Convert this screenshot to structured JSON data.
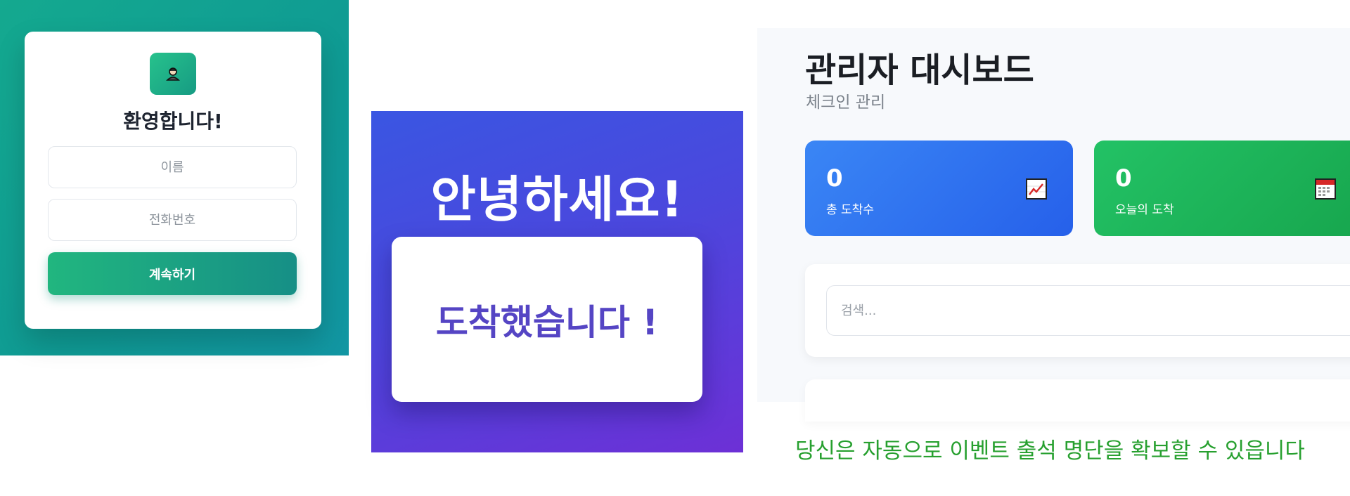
{
  "login": {
    "title": "환영합니다!",
    "name_placeholder": "이름",
    "phone_placeholder": "전화번호",
    "submit_label": "계속하기",
    "logo_icon": "user-avatar-icon",
    "accent_color": "#14a98f"
  },
  "greeting": {
    "title": "안녕하세요!",
    "message": "도착했습니다 !",
    "accent_color": "#4b47dd"
  },
  "dashboard": {
    "title": "관리자 대시보드",
    "subtitle": "체크인 관리",
    "stats": [
      {
        "value": "0",
        "label": "총 도착수",
        "icon": "chart-increasing-icon",
        "color": "#2f6ff0"
      },
      {
        "value": "0",
        "label": "오늘의 도착",
        "icon": "calendar-icon",
        "color": "#1fb45a"
      }
    ],
    "search_placeholder": "검색..."
  },
  "caption": {
    "text": "당신은 자동으로 이벤트 출석 명단을 확보할 수 있읍니다",
    "color": "#27a02f"
  }
}
